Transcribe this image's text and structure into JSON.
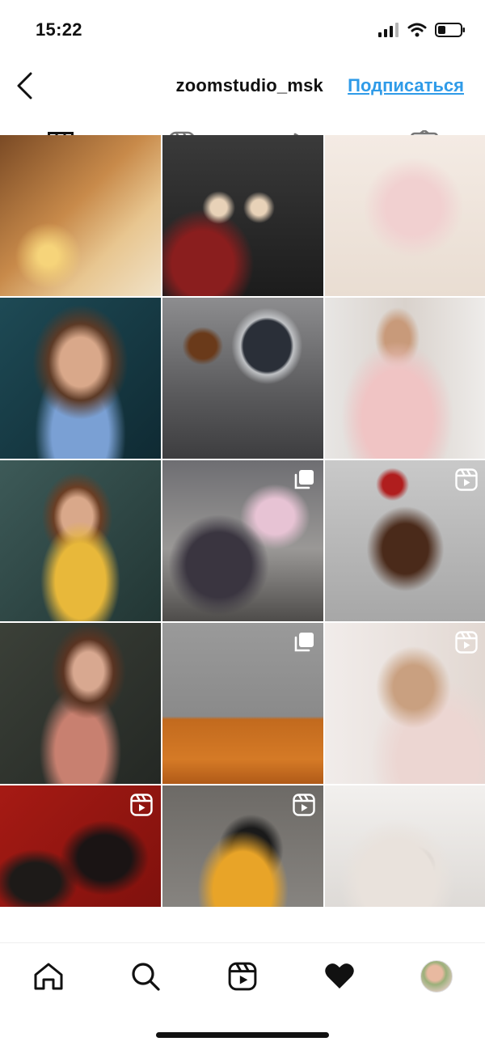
{
  "status_bar": {
    "time": "15:22"
  },
  "header": {
    "username": "zoomstudio_msk",
    "follow_label": "Подписаться"
  },
  "tabs": [
    {
      "icon": "grid-icon",
      "active": true
    },
    {
      "icon": "reels-icon",
      "active": false
    },
    {
      "icon": "play-icon",
      "active": false
    },
    {
      "icon": "tagged-icon",
      "active": false
    }
  ],
  "grid": {
    "posts": [
      {
        "bg": "radial-gradient(circle at 30% 75%, #f6d47a 0 6%, transparent 20%), linear-gradient(135deg,#7a4a25 0%,#c88a4a 45%,#e8c690 70%,#f0e2c8 100%)",
        "badge": ""
      },
      {
        "bg": "radial-gradient(circle at 35% 45%, #e8d2b8 0 6%, transparent 12%), radial-gradient(circle at 60% 45%, #e8d2b8 0 6%, transparent 12%), radial-gradient(ellipse at 25% 80%, #8a1e1e 0 18%, transparent 30%), linear-gradient(180deg,#3a3a3a 0%,#1c1c1c 100%)",
        "badge": ""
      },
      {
        "bg": "radial-gradient(ellipse at 55% 45%, #f1d0d0 0 22%, transparent 40%), linear-gradient(180deg,#f4ebe4 0%,#e9ddd2 100%)",
        "badge": ""
      },
      {
        "bg": "radial-gradient(ellipse at 50% 40%, #d9a88a 0 18%, #5c3a26 28%, transparent 42%), radial-gradient(ellipse at 50% 85%, #7aa0d4 0 25%, transparent 40%), linear-gradient(135deg,#1e4a55 0%,#0f2a33 100%)",
        "badge": ""
      },
      {
        "bg": "radial-gradient(ellipse at 65% 30%, #2a2f38 0 16%, #bfc1c4 18%, transparent 24%), radial-gradient(ellipse at 25% 30%, #6a3a1a 0 8%, transparent 12%), linear-gradient(180deg,#8d8d8f 0%,#5a5a5c 60%,#3d3d3f 100%)",
        "badge": ""
      },
      {
        "bg": "radial-gradient(ellipse at 45% 75%, #f0c4c4 0 28%, transparent 45%), radial-gradient(ellipse at 45% 25%, #c89a7a 0 10%, transparent 18%), linear-gradient(90deg,#e8e6e4 0%,#d9d2cc 50%,#eeecea 100%)",
        "badge": ""
      },
      {
        "bg": "radial-gradient(ellipse at 50% 75%, #e8b83a 0 22%, transparent 35%), radial-gradient(ellipse at 48% 35%, #d9a88a 0 13%, #6a3e24 20%, transparent 30%), linear-gradient(135deg,#3d5a58 0%,#223634 100%)",
        "badge": ""
      },
      {
        "bg": "radial-gradient(ellipse at 35% 65%, #3a3540 0 22%, transparent 34%), radial-gradient(ellipse at 70% 35%, #e7c3d4 0 12%, transparent 22%), linear-gradient(180deg,#6e6e72 0%,#9a9896 55%,#4e4c4a 100%)",
        "badge": "carousel"
      },
      {
        "bg": "radial-gradient(circle at 42% 15%, #b01e1e 0 6%, transparent 10%), radial-gradient(ellipse at 50% 55%, #4a2a1a 0 20%, transparent 34%), linear-gradient(180deg,#c9c9c9 0%,#a7a7a7 100%)",
        "badge": "reel"
      },
      {
        "bg": "radial-gradient(ellipse at 55% 30%, #d8a890 0 12%, #5a3422 20%, transparent 30%), radial-gradient(ellipse at 50% 80%, #c88070 0 22%, transparent 36%), linear-gradient(135deg,#3b4038 0%,#242824 100%)",
        "badge": ""
      },
      {
        "bg": "linear-gradient(180deg,#9a9a9a 0%,#8a8a8a 58%,#c26a1e 60%,#d57a26 85%,#b05a18 100%)",
        "badge": "carousel"
      },
      {
        "bg": "radial-gradient(ellipse at 55% 40%, #c9a080 0 16%, transparent 30%), radial-gradient(ellipse at 70% 85%, #ecd6d2 0 25%, transparent 42%), linear-gradient(90deg,#f1ecea 0%,#e2d8d2 100%)",
        "badge": "reel"
      },
      {
        "bg": "radial-gradient(ellipse at 65% 45%, #1a1414 0 18%, transparent 30%), radial-gradient(ellipse at 22% 60%, #1d1a18 0 14%, transparent 24%), linear-gradient(135deg,#a61a14 0%,#7a100c 100%)",
        "badge": "reel"
      },
      {
        "bg": "radial-gradient(ellipse at 50% 65%, #e8a428 0 26%, transparent 40%), radial-gradient(ellipse at 55% 40%, #1a1a1a 0 16%, transparent 26%), linear-gradient(180deg,#6d6a66 0%,#8f8c88 100%)",
        "badge": "reel"
      },
      {
        "bg": "radial-gradient(ellipse at 45% 60%, #e9e2dc 0 30%, transparent 46%), radial-gradient(ellipse at 55% 50%, #1a1a1a 0 10%, transparent 18%), linear-gradient(180deg,#f2f0ee 0%,#d7d3cf 100%)",
        "badge": ""
      }
    ]
  },
  "bottom_nav": [
    {
      "icon": "home-icon"
    },
    {
      "icon": "search-icon"
    },
    {
      "icon": "reels-icon"
    },
    {
      "icon": "heart-icon"
    },
    {
      "icon": "profile-avatar"
    }
  ],
  "colors": {
    "accent": "#2f9be8",
    "text": "#111111"
  }
}
